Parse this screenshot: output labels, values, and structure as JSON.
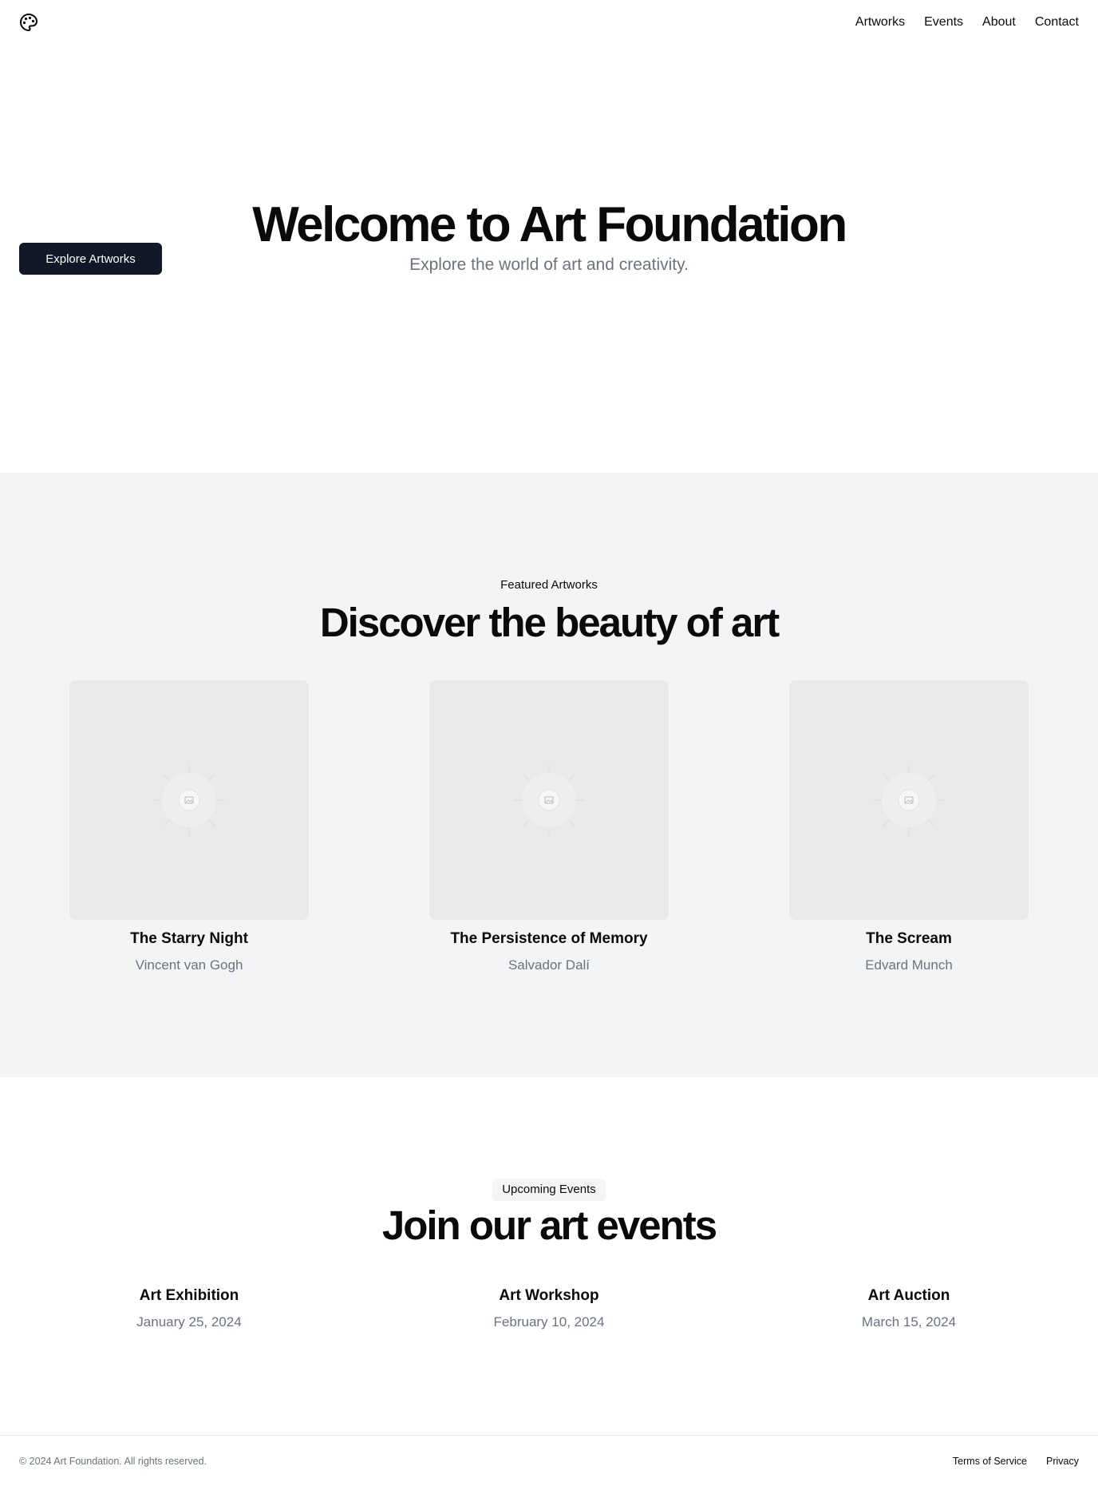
{
  "header": {
    "logo_icon": "palette-icon",
    "nav": [
      "Artworks",
      "Events",
      "About",
      "Contact"
    ]
  },
  "hero": {
    "title": "Welcome to Art Foundation",
    "subtitle": "Explore the world of art and creativity.",
    "button": "Explore Artworks"
  },
  "featured": {
    "eyebrow": "Featured Artworks",
    "title": "Discover the beauty of art",
    "artworks": [
      {
        "title": "The Starry Night",
        "artist": "Vincent van Gogh",
        "image_icon": "image-placeholder-icon"
      },
      {
        "title": "The Persistence of Memory",
        "artist": "Salvador Dalí",
        "image_icon": "image-placeholder-icon"
      },
      {
        "title": "The Scream",
        "artist": "Edvard Munch",
        "image_icon": "image-placeholder-icon"
      }
    ]
  },
  "events": {
    "badge": "Upcoming Events",
    "title": "Join our art events",
    "items": [
      {
        "title": "Art Exhibition",
        "date": "January 25, 2024"
      },
      {
        "title": "Art Workshop",
        "date": "February 10, 2024"
      },
      {
        "title": "Art Auction",
        "date": "March 15, 2024"
      }
    ]
  },
  "footer": {
    "copyright": "© 2024 Art Foundation. All rights reserved.",
    "links": [
      "Terms of Service",
      "Privacy"
    ]
  },
  "colors": {
    "primary_button": "#111827",
    "section_bg": "#f3f4f6",
    "muted_text": "#6b7280",
    "placeholder_bg": "#e9e9e9"
  }
}
